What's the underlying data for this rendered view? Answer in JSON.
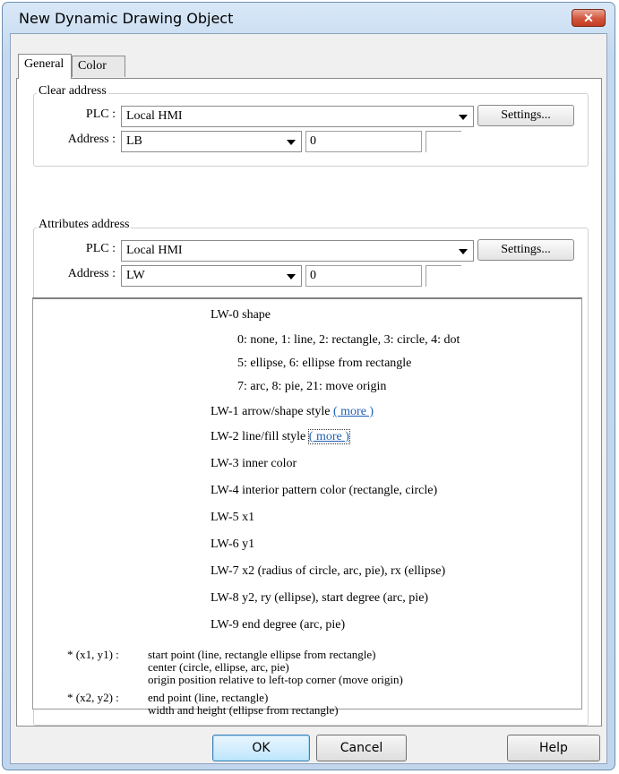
{
  "window": {
    "title": "New Dynamic Drawing Object",
    "close_icon": "close-icon"
  },
  "tabs": [
    {
      "label": "General",
      "active": true
    },
    {
      "label": "Color",
      "active": false
    }
  ],
  "clear_address": {
    "legend": "Clear address",
    "plc_label": "PLC :",
    "plc_value": "Local HMI",
    "settings_label": "Settings...",
    "address_label": "Address :",
    "device_value": "LB",
    "address_value": "0"
  },
  "attributes_address": {
    "legend": "Attributes address",
    "plc_label": "PLC :",
    "plc_value": "Local HMI",
    "settings_label": "Settings...",
    "address_label": "Address :",
    "device_value": "LW",
    "address_value": "0"
  },
  "info": {
    "lw0": "LW-0 shape",
    "lw0_opt1": "0: none, 1: line, 2: rectangle, 3: circle, 4: dot",
    "lw0_opt2": "5: ellipse, 6: ellipse from rectangle",
    "lw0_opt3": "7: arc, 8: pie, 21: move origin",
    "lw1": "LW-1 arrow/shape style",
    "lw1_more": "( more )",
    "lw2": "LW-2 line/fill style",
    "lw2_more": "( more )",
    "lw3": "LW-3 inner color",
    "lw4": "LW-4 interior pattern color (rectangle, circle)",
    "lw5": "LW-5 x1",
    "lw6": "LW-6 y1",
    "lw7": "LW-7 x2 (radius of circle, arc, pie), rx (ellipse)",
    "lw8": "LW-8 y2, ry (ellipse), start degree (arc, pie)",
    "lw9": "LW-9 end degree (arc, pie)",
    "note1_key": "* (x1, y1) :",
    "note1_l1": "start point (line, rectangle ellipse from rectangle)",
    "note1_l2": "center (circle, ellipse, arc, pie)",
    "note1_l3": "origin position relative to left-top corner (move origin)",
    "note2_key": "* (x2, y2) :",
    "note2_l1": "end point (line, rectangle)",
    "note2_l2": "width and height (ellipse from rectangle)"
  },
  "buttons": {
    "ok": "OK",
    "cancel": "Cancel",
    "help": "Help"
  }
}
